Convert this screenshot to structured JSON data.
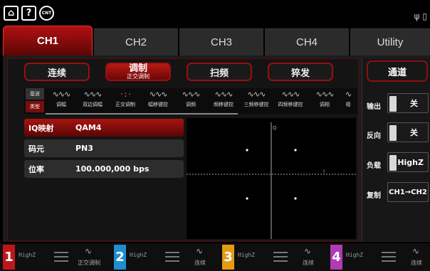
{
  "statusbar": {
    "home_icon": "house-icon",
    "help_label": "?",
    "counter_label": "CNT",
    "right_icons": "usb-icon"
  },
  "tabs": [
    {
      "label": "CH1",
      "active": true
    },
    {
      "label": "CH2"
    },
    {
      "label": "CH3"
    },
    {
      "label": "CH4"
    },
    {
      "label": "Utility"
    }
  ],
  "modes": {
    "continuous": "连续",
    "modulation": "调制",
    "modulation_sub": "正交调制",
    "sweep": "扫频",
    "burst": "猝发"
  },
  "wave_types": {
    "basic": "基波",
    "type": "类型"
  },
  "modulations": [
    {
      "label": "调幅",
      "icon": "∿∿∿"
    },
    {
      "label": "双边调幅",
      "icon": "∿∿∿"
    },
    {
      "label": "正交调制",
      "icon": "·:·",
      "active": true
    },
    {
      "label": "幅移键控",
      "icon": "∿∿∿"
    },
    {
      "label": "调频",
      "icon": "∿∿∿"
    },
    {
      "label": "频移键控",
      "icon": "∿∿∿"
    },
    {
      "label": "三频移键控",
      "icon": "∿∿∿"
    },
    {
      "label": "四频移键控",
      "icon": "∿∿∿"
    },
    {
      "label": "调相",
      "icon": "∿∿∿"
    },
    {
      "label": "相",
      "icon": "∿"
    }
  ],
  "params": [
    {
      "key": "IQ映射",
      "value": "QAM4"
    },
    {
      "key": "码元",
      "value": "PN3"
    },
    {
      "key": "位率",
      "value": "100.000,000 bps"
    }
  ],
  "constellation": {
    "y_label": "Q",
    "x_label": "I",
    "points": [
      [
        1,
        1
      ],
      [
        -1,
        1
      ],
      [
        1,
        -1
      ],
      [
        -1,
        -1
      ]
    ]
  },
  "channel_panel": {
    "title": "通道",
    "output_label": "输出",
    "output_value": "关",
    "invert_label": "反向",
    "invert_value": "关",
    "load_label": "负载",
    "load_value": "HighZ",
    "copy_label": "复制",
    "copy_value": "CH1→CH2"
  },
  "channels": [
    {
      "num": "1",
      "impedance": "HighZ",
      "mode": "正交调制",
      "color": "#c0161a"
    },
    {
      "num": "2",
      "impedance": "HighZ",
      "mode": "连续",
      "color": "#1d8fd0"
    },
    {
      "num": "3",
      "impedance": "HighZ",
      "mode": "连续",
      "color": "#e59a14"
    },
    {
      "num": "4",
      "impedance": "HighZ",
      "mode": "连续",
      "color": "#b13ab5"
    }
  ]
}
